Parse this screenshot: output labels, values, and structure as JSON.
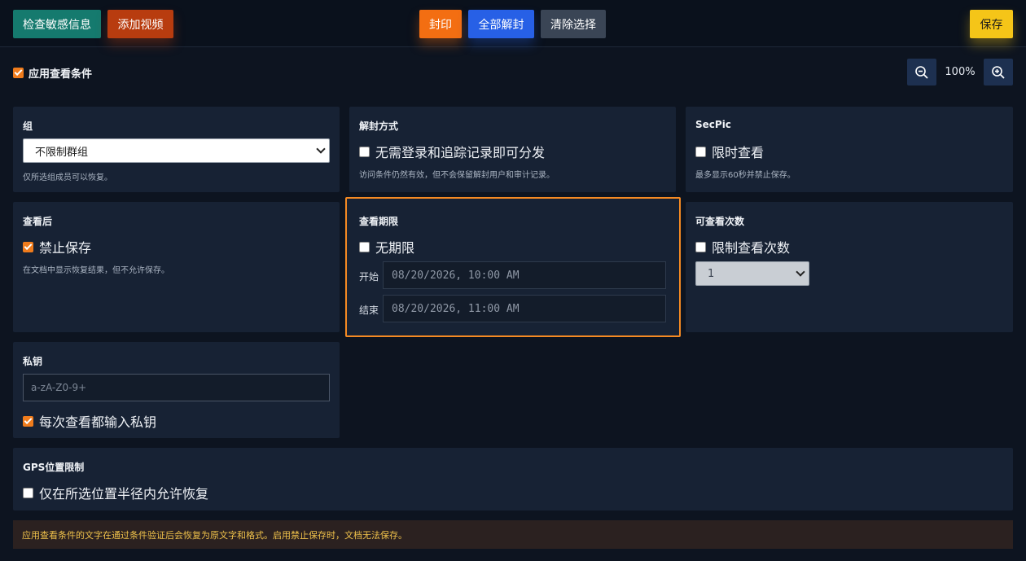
{
  "toolbar": {
    "check_sensitive": "检查敏感信息",
    "add_video": "添加视频",
    "seal": "封印",
    "unseal_all": "全部解封",
    "clear_selection": "清除选择",
    "save": "保存"
  },
  "apply_conditions": {
    "label": "应用查看条件",
    "checked": true
  },
  "zoom": {
    "level": "100%"
  },
  "cards": {
    "group": {
      "title": "组",
      "selected": "不限制群组",
      "hint": "仅所选组成员可以恢复。"
    },
    "unseal_method": {
      "title": "解封方式",
      "option": "无需登录和追踪记录即可分发",
      "hint": "访问条件仍然有效，但不会保留解封用户和审计记录。"
    },
    "secpic": {
      "title": "SecPic",
      "option": "限时查看",
      "hint": "最多显示60秒并禁止保存。"
    },
    "after_view": {
      "title": "查看后",
      "option": "禁止保存",
      "hint": "在文档中显示恢复结果，但不允许保存。"
    },
    "view_period": {
      "title": "查看期限",
      "option": "无期限",
      "start_label": "开始",
      "start_value": "08/20/2026, 10:00 AM",
      "end_label": "结束",
      "end_value": "08/20/2026, 11:00 AM"
    },
    "view_count": {
      "title": "可查看次数",
      "option": "限制查看次数",
      "selected": "1"
    },
    "private_key": {
      "title": "私钥",
      "placeholder": "a-zA-Z0-9+",
      "option": "每次查看都输入私钥"
    },
    "gps": {
      "title": "GPS位置限制",
      "option": "仅在所选位置半径内允许恢复"
    }
  },
  "notice": "应用查看条件的文字在通过条件验证后会恢复为原文字和格式。启用禁止保存时，文档无法保存。",
  "colors": {
    "background": "#0d1420",
    "card": "#172234",
    "accent_orange": "#f58a23",
    "notice_text": "#f0c24b"
  }
}
